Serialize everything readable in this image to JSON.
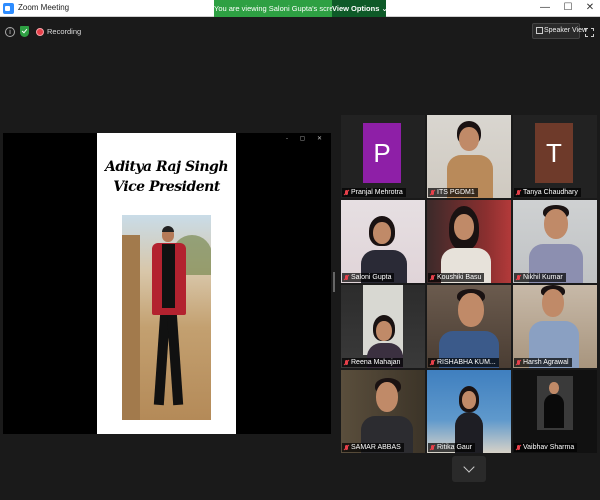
{
  "window": {
    "title": "Zoom Meeting",
    "share_banner": "You are viewing Saloni Gupta's screen",
    "view_options": "View Options ⌄",
    "controls": {
      "minimize": "—",
      "maximize": "☐",
      "close": "✕"
    }
  },
  "topbar": {
    "info": "i",
    "recording": "Recording",
    "speaker_view": "Speaker View"
  },
  "share": {
    "tools": "- ▢ ✕",
    "slide": {
      "name": "Aditya Raj Singh",
      "role": "Vice President"
    }
  },
  "participants": [
    {
      "name": "Pranjal Mehrotra",
      "avatar_letter": "P",
      "avatar_color": "#8e1fa7"
    },
    {
      "name": "ITS PGDM1"
    },
    {
      "name": "Tanya Chaudhary",
      "avatar_letter": "T",
      "avatar_color": "#6e3a2a"
    },
    {
      "name": "Saloni Gupta"
    },
    {
      "name": "Koushiki Basu"
    },
    {
      "name": "Nikhil Kumar"
    },
    {
      "name": "Reena Mahajan"
    },
    {
      "name": "RISHABHA KUM..."
    },
    {
      "name": "Harsh Agrawal"
    },
    {
      "name": "SAMAR ABBAS"
    },
    {
      "name": "Ritika Gaur"
    },
    {
      "name": "Vaibhav Sharma"
    }
  ],
  "colors": {
    "share_banner": "#2ea043",
    "view_options": "#0e5a28",
    "active_speaker": "#e6d05b",
    "muted": "#e8404a"
  }
}
